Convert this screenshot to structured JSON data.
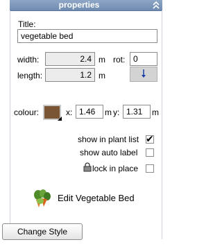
{
  "panel": {
    "title": "properties"
  },
  "title_label": "Title:",
  "title_value": "vegetable bed",
  "width": {
    "label": "width:",
    "value": "2.4",
    "unit": "m"
  },
  "length": {
    "label": "length:",
    "value": "1.2",
    "unit": "m"
  },
  "rot": {
    "label": "rot:",
    "value": "0"
  },
  "colour": {
    "label": "colour:",
    "hex": "#7a5534"
  },
  "x": {
    "label": "x:",
    "value": "1.46",
    "unit": "m"
  },
  "y": {
    "label": "y:",
    "value": "1.31",
    "unit": "m"
  },
  "options": {
    "show_in_plant_list": {
      "label": "show in plant list",
      "checked": true
    },
    "show_auto_label": {
      "label": "show auto label",
      "checked": false
    },
    "lock_in_place": {
      "label": "lock in place",
      "checked": false
    }
  },
  "edit_label": "Edit Vegetable Bed",
  "change_style_label": "Change Style"
}
